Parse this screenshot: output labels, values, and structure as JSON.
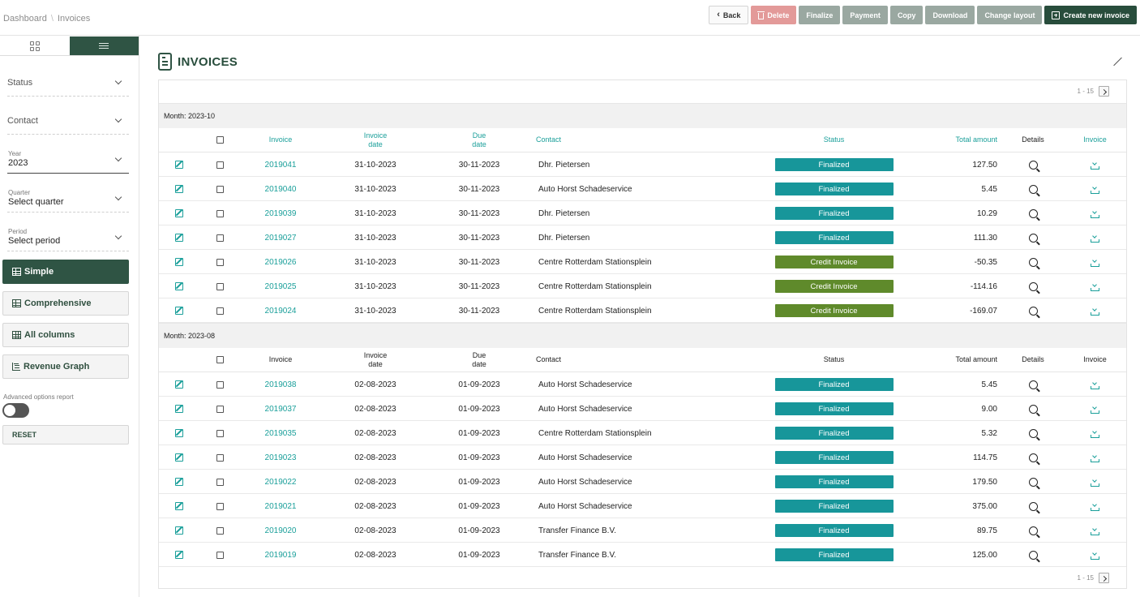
{
  "breadcrumb": [
    "Dashboard",
    "Invoices"
  ],
  "toolbar": {
    "back": "Back",
    "delete": "Delete",
    "finalize": "Finalize",
    "payment": "Payment",
    "copy": "Copy",
    "download": "Download",
    "change_layout": "Change layout",
    "create": "Create new invoice"
  },
  "colors": {
    "primary": "#284d3c",
    "teal": "#1a9f9a",
    "finalized": "#17969a",
    "credit": "#5f8a2b",
    "delete": "#e39a99",
    "grey_button": "#9aa8a1"
  },
  "sidebar": {
    "status_label": "Status",
    "contact_label": "Contact",
    "year_label": "Year",
    "year_value": "2023",
    "quarter_label": "Quarter",
    "quarter_value": "Select quarter",
    "period_label": "Period",
    "period_value": "Select period",
    "layouts": [
      "Simple",
      "Comprehensive",
      "All columns",
      "Revenue Graph"
    ],
    "advanced_label": "Advanced options report",
    "reset": "RESET"
  },
  "page": {
    "title": "INVOICES"
  },
  "pager": {
    "range": "1 - 15"
  },
  "table": {
    "headers": {
      "invoice": "Invoice",
      "invoice_date_1": "Invoice",
      "invoice_date_2": "date",
      "due_1": "Due",
      "due_2": "date",
      "contact": "Contact",
      "status": "Status",
      "total": "Total amount",
      "details": "Details",
      "invoice_file": "Invoice"
    },
    "groups": [
      {
        "month": "Month: 2023-10",
        "rows": [
          {
            "invoice": "2019041",
            "date": "31-10-2023",
            "due": "30-11-2023",
            "contact": "Dhr. Pietersen",
            "status": "Finalized",
            "total": "127.50"
          },
          {
            "invoice": "2019040",
            "date": "31-10-2023",
            "due": "30-11-2023",
            "contact": "Auto Horst Schadeservice",
            "status": "Finalized",
            "total": "5.45"
          },
          {
            "invoice": "2019039",
            "date": "31-10-2023",
            "due": "30-11-2023",
            "contact": "Dhr. Pietersen",
            "status": "Finalized",
            "total": "10.29"
          },
          {
            "invoice": "2019027",
            "date": "31-10-2023",
            "due": "30-11-2023",
            "contact": "Dhr. Pietersen",
            "status": "Finalized",
            "total": "111.30"
          },
          {
            "invoice": "2019026",
            "date": "31-10-2023",
            "due": "30-11-2023",
            "contact": "Centre Rotterdam Stationsplein",
            "status": "Credit Invoice",
            "total": "-50.35"
          },
          {
            "invoice": "2019025",
            "date": "31-10-2023",
            "due": "30-11-2023",
            "contact": "Centre Rotterdam Stationsplein",
            "status": "Credit Invoice",
            "total": "-114.16"
          },
          {
            "invoice": "2019024",
            "date": "31-10-2023",
            "due": "30-11-2023",
            "contact": "Centre Rotterdam Stationsplein",
            "status": "Credit Invoice",
            "total": "-169.07"
          }
        ]
      },
      {
        "month": "Month: 2023-08",
        "rows": [
          {
            "invoice": "2019038",
            "date": "02-08-2023",
            "due": "01-09-2023",
            "contact": "Auto Horst Schadeservice",
            "status": "Finalized",
            "total": "5.45"
          },
          {
            "invoice": "2019037",
            "date": "02-08-2023",
            "due": "01-09-2023",
            "contact": "Auto Horst Schadeservice",
            "status": "Finalized",
            "total": "9.00"
          },
          {
            "invoice": "2019035",
            "date": "02-08-2023",
            "due": "01-09-2023",
            "contact": "Centre Rotterdam Stationsplein",
            "status": "Finalized",
            "total": "5.32"
          },
          {
            "invoice": "2019023",
            "date": "02-08-2023",
            "due": "01-09-2023",
            "contact": "Auto Horst Schadeservice",
            "status": "Finalized",
            "total": "114.75"
          },
          {
            "invoice": "2019022",
            "date": "02-08-2023",
            "due": "01-09-2023",
            "contact": "Auto Horst Schadeservice",
            "status": "Finalized",
            "total": "179.50"
          },
          {
            "invoice": "2019021",
            "date": "02-08-2023",
            "due": "01-09-2023",
            "contact": "Auto Horst Schadeservice",
            "status": "Finalized",
            "total": "375.00"
          },
          {
            "invoice": "2019020",
            "date": "02-08-2023",
            "due": "01-09-2023",
            "contact": "Transfer Finance B.V.",
            "status": "Finalized",
            "total": "89.75"
          },
          {
            "invoice": "2019019",
            "date": "02-08-2023",
            "due": "01-09-2023",
            "contact": "Transfer Finance B.V.",
            "status": "Finalized",
            "total": "125.00"
          }
        ]
      }
    ]
  }
}
